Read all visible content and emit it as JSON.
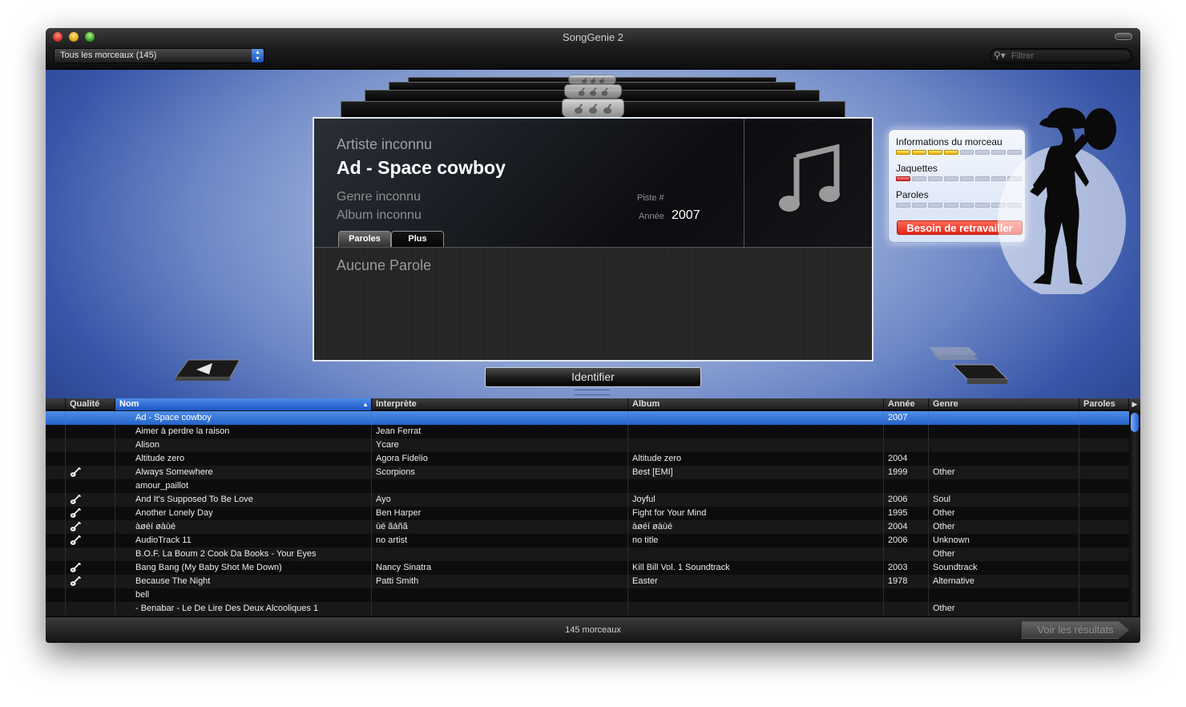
{
  "window": {
    "title": "SongGenie 2"
  },
  "toolbar": {
    "source_select": "Tous les morceaux (145)",
    "filter_placeholder": "Filtrer"
  },
  "song": {
    "artist": "Artiste inconnu",
    "title": "Ad - Space cowboy",
    "genre": "Genre inconnu",
    "album": "Album inconnu",
    "track_label": "Piste #",
    "year_label": "Année",
    "year": "2007",
    "tabs": [
      "Paroles",
      "Plus"
    ],
    "lyrics": "Aucune Parole"
  },
  "quality": {
    "info_label": "Informations du morceau",
    "info_level": 4,
    "covers_label": "Jaquettes",
    "covers_level": 1,
    "lyrics_label": "Paroles",
    "lyrics_level": 0,
    "meter_segments": 8,
    "rework_button": "Besoin de retravailler"
  },
  "identify_button": "Identifier",
  "table": {
    "columns": [
      "Qualité",
      "Nom",
      "Interprète",
      "Album",
      "Année",
      "Genre",
      "Paroles"
    ],
    "rows": [
      {
        "quality": false,
        "name": "Ad - Space cowboy",
        "artist": "",
        "album": "",
        "year": "2007",
        "genre": "",
        "selected": true
      },
      {
        "quality": false,
        "name": "Aimer à perdre la raison",
        "artist": " Jean Ferrat",
        "album": "",
        "year": "",
        "genre": ""
      },
      {
        "quality": false,
        "name": "Alison",
        "artist": "Ycare",
        "album": "",
        "year": "",
        "genre": ""
      },
      {
        "quality": false,
        "name": "Altitude zero",
        "artist": "Agora Fidelio",
        "album": "Altitude zero",
        "year": "2004",
        "genre": ""
      },
      {
        "quality": true,
        "name": "Always Somewhere",
        "artist": "Scorpions",
        "album": "Best [EMI]",
        "year": "1999",
        "genre": "Other"
      },
      {
        "quality": false,
        "name": "amour_paillot",
        "artist": "",
        "album": "",
        "year": "",
        "genre": ""
      },
      {
        "quality": true,
        "name": "And It's Supposed To Be Love",
        "artist": "Ayo",
        "album": "Joyful",
        "year": "2006",
        "genre": "Soul"
      },
      {
        "quality": true,
        "name": "Another Lonely Day",
        "artist": "Ben Harper",
        "album": "Fight for Your Mind",
        "year": "1995",
        "genre": "Other"
      },
      {
        "quality": true,
        "name": "àøéí øàùé",
        "artist": "ùé ãáñã",
        "album": "àøéí øàùé",
        "year": "2004",
        "genre": "Other"
      },
      {
        "quality": true,
        "name": "AudioTrack 11",
        "artist": "no artist",
        "album": "no title",
        "year": "2006",
        "genre": "Unknown"
      },
      {
        "quality": false,
        "name": "B.O.F. La Boum 2 Cook Da Books - Your Eyes",
        "artist": "",
        "album": "",
        "year": "",
        "genre": "Other"
      },
      {
        "quality": true,
        "name": "Bang Bang (My Baby Shot Me Down)",
        "artist": "Nancy Sinatra",
        "album": "Kill Bill Vol. 1 Soundtrack",
        "year": "2003",
        "genre": "Soundtrack"
      },
      {
        "quality": true,
        "name": "Because The Night",
        "artist": "Patti Smith",
        "album": "Easter",
        "year": "1978",
        "genre": "Alternative"
      },
      {
        "quality": false,
        "name": "bell",
        "artist": "",
        "album": "",
        "year": "",
        "genre": ""
      },
      {
        "quality": false,
        "name": " - Benabar - Le De Lire Des Deux Alcooliques 1",
        "artist": "",
        "album": "",
        "year": "",
        "genre": "Other"
      }
    ]
  },
  "status": {
    "count": "145 morceaux",
    "results_button": "Voir les résultats"
  },
  "icons": {
    "quality_marker": "guitar-icon",
    "album_art": "music-note-icon",
    "search": "search-icon",
    "mascot": "cowgirl-silhouette-icon"
  },
  "colors": {
    "selection": "#2f6fd6",
    "meter_info": "#e5b400",
    "meter_covers": "#d8242a",
    "rework_button": "#e3241b",
    "stage": "#6e88c7"
  }
}
